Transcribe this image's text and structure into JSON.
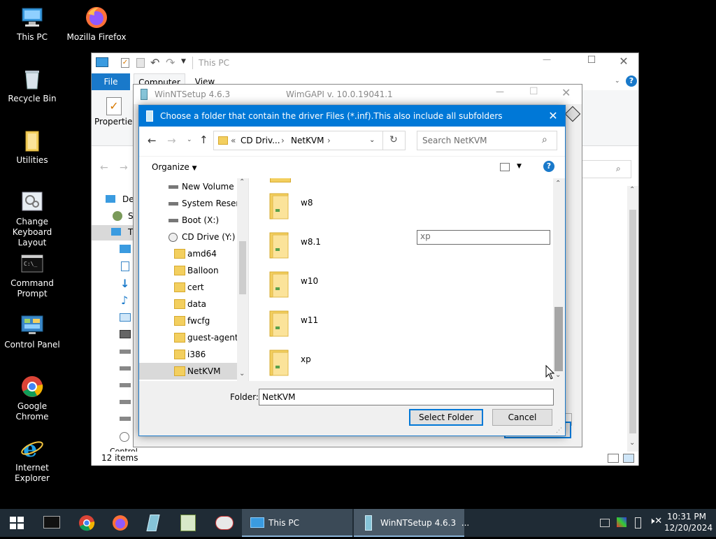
{
  "desktop": {
    "icons": [
      {
        "label": "This PC"
      },
      {
        "label": "Mozilla Firefox"
      },
      {
        "label": "Recycle Bin"
      },
      {
        "label": "Utilities"
      },
      {
        "label": "Change Keyboard Layout"
      },
      {
        "label": "Command Prompt"
      },
      {
        "label": "Control Panel"
      },
      {
        "label": "Google Chrome"
      },
      {
        "label": "Internet Explorer"
      }
    ]
  },
  "explorer": {
    "title": "This PC",
    "tabs": {
      "file": "File",
      "computer": "Computer",
      "view": "View"
    },
    "ribbon_properties": "Properties",
    "sidebar_partial": [
      "Des",
      "SV",
      "Th"
    ],
    "sidebar_bottom_partial": "Control Panel",
    "status": "12 items"
  },
  "winnt": {
    "title": "WinNTSetup 4.6.3",
    "wimgapi": "WimGAPI v. 10.0.19041.1"
  },
  "dialog": {
    "title": "Choose a folder that contain the driver Files (*.inf).This also include all subfolders",
    "breadcrumb": {
      "root": "«",
      "cd": "CD Driv...",
      "folder": "NetKVM"
    },
    "search_placeholder": "Search NetKVM",
    "organize": "Organize",
    "tree": [
      {
        "label": "New Volume (E"
      },
      {
        "label": "System Reserve"
      },
      {
        "label": "Boot (X:)"
      },
      {
        "label": "CD Drive (Y:) vi"
      },
      {
        "label": "amd64"
      },
      {
        "label": "Balloon"
      },
      {
        "label": "cert"
      },
      {
        "label": "data"
      },
      {
        "label": "fwcfg"
      },
      {
        "label": "guest-agent"
      },
      {
        "label": "i386"
      },
      {
        "label": "NetKVM"
      }
    ],
    "files": [
      {
        "label": "w8"
      },
      {
        "label": "w8.1"
      },
      {
        "label": "w10"
      },
      {
        "label": "w11"
      },
      {
        "label": "xp"
      }
    ],
    "rename_value": "xp",
    "folder_label": "Folder:",
    "folder_value": "NetKVM",
    "select_button": "Select Folder",
    "cancel_button": "Cancel"
  },
  "taskbar": {
    "tasks": [
      {
        "label": "This PC"
      },
      {
        "label": "WinNTSetup 4.6.3  ..."
      }
    ],
    "time": "10:31 PM",
    "date": "12/20/2024"
  },
  "colors": {
    "accent": "#0078d7",
    "taskbar": "#1f2b35",
    "folder": "#f3cf5f"
  }
}
